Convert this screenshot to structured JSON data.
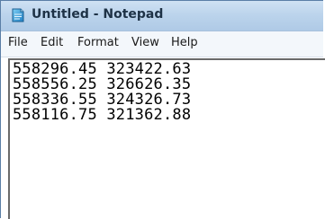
{
  "window": {
    "title": "Untitled - Notepad",
    "icon": "notepad-icon"
  },
  "menubar": {
    "items": [
      {
        "label": "File"
      },
      {
        "label": "Edit"
      },
      {
        "label": "Format"
      },
      {
        "label": "View"
      },
      {
        "label": "Help"
      }
    ]
  },
  "editor": {
    "lines": [
      "558296.45 323422.63",
      "558556.25 326626.35",
      "558336.55 324326.73",
      "558116.75 321362.88"
    ]
  },
  "colors": {
    "titlebar": "#bcd4ec",
    "menubar": "#f3f7fb",
    "text": "#000000"
  }
}
